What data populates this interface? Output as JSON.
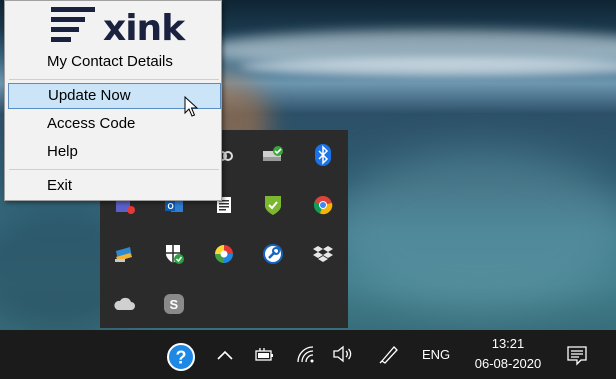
{
  "context_menu": {
    "brand": "xink",
    "items": [
      {
        "label": "My Contact Details"
      },
      {
        "label": "Update Now"
      },
      {
        "label": "Access Code"
      },
      {
        "label": "Help"
      },
      {
        "label": "Exit"
      }
    ]
  },
  "tray_overflow": {
    "icons": [
      "camera-app-icon",
      "network-drive-sync-icon",
      "bluetooth-icon",
      "teams-icon",
      "outlook-icon",
      "notes-icon",
      "security-shield-check-icon",
      "chrome-icon",
      "sync-app-icon",
      "windows-security-icon",
      "color-picker-icon",
      "wrench-tool-icon",
      "dropbox-icon",
      "onedrive-icon",
      "skype-icon"
    ]
  },
  "taskbar": {
    "language": "ENG",
    "time": "13:21",
    "date": "06-08-2020",
    "tray_icons": [
      "xink-help-icon",
      "chevron-up-icon",
      "battery-icon",
      "wifi-icon",
      "speaker-icon",
      "pen-icon",
      "notifications-icon"
    ]
  },
  "colors": {
    "menu_highlight": "#cce4f7",
    "menu_highlight_border": "#5a8fc4",
    "taskbar_bg": "#1b1b1b",
    "tray_panel_bg": "#2b2b2b",
    "xink_navy": "#1a2240"
  }
}
